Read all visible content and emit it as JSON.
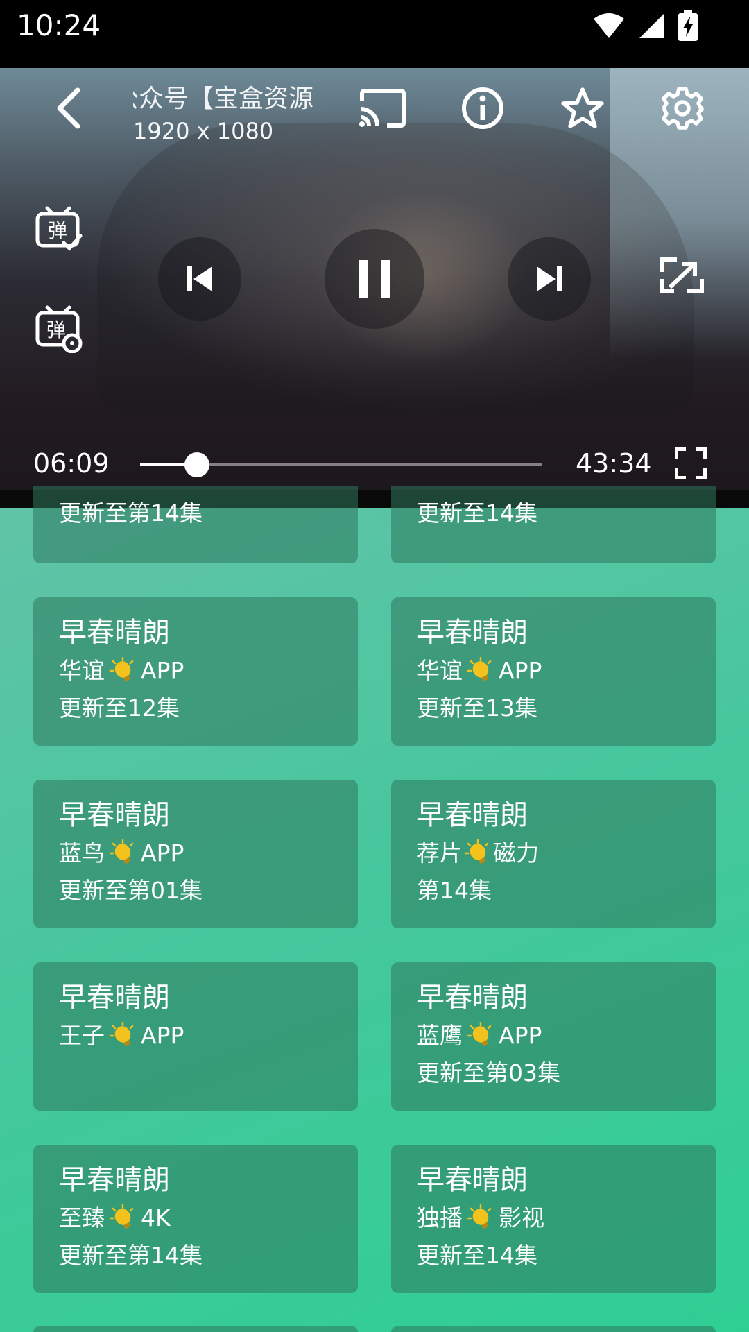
{
  "status_bar": {
    "time": "10:24"
  },
  "player": {
    "title": "公众号【宝盒资源】",
    "resolution": "1920 x 1080",
    "current_time": "06:09",
    "duration": "43:34",
    "progress": 0.141
  },
  "cards_partial": [
    {
      "episode": "更新至第14集"
    },
    {
      "episode": "更新至14集"
    }
  ],
  "cards": [
    {
      "title": "早春晴朗",
      "source_pre": "华谊",
      "source_post": "APP",
      "episode": "更新至12集"
    },
    {
      "title": "早春晴朗",
      "source_pre": "华谊",
      "source_post": "APP",
      "episode": "更新至13集"
    },
    {
      "title": "早春晴朗",
      "source_pre": "蓝鸟",
      "source_post": "APP",
      "episode": "更新至第01集"
    },
    {
      "title": "早春晴朗",
      "source_pre": "荐片",
      "source_post": "磁力",
      "episode": "第14集"
    },
    {
      "title": "早春晴朗",
      "source_pre": "王子",
      "source_post": "APP",
      "episode": ""
    },
    {
      "title": "早春晴朗",
      "source_pre": "蓝鹰",
      "source_post": "APP",
      "episode": "更新至第03集"
    },
    {
      "title": "早春晴朗",
      "source_pre": "至臻",
      "source_post": "4K",
      "episode": "更新至第14集"
    },
    {
      "title": "早春晴朗",
      "source_pre": "独播",
      "source_post": "影视",
      "episode": "更新至14集"
    }
  ]
}
